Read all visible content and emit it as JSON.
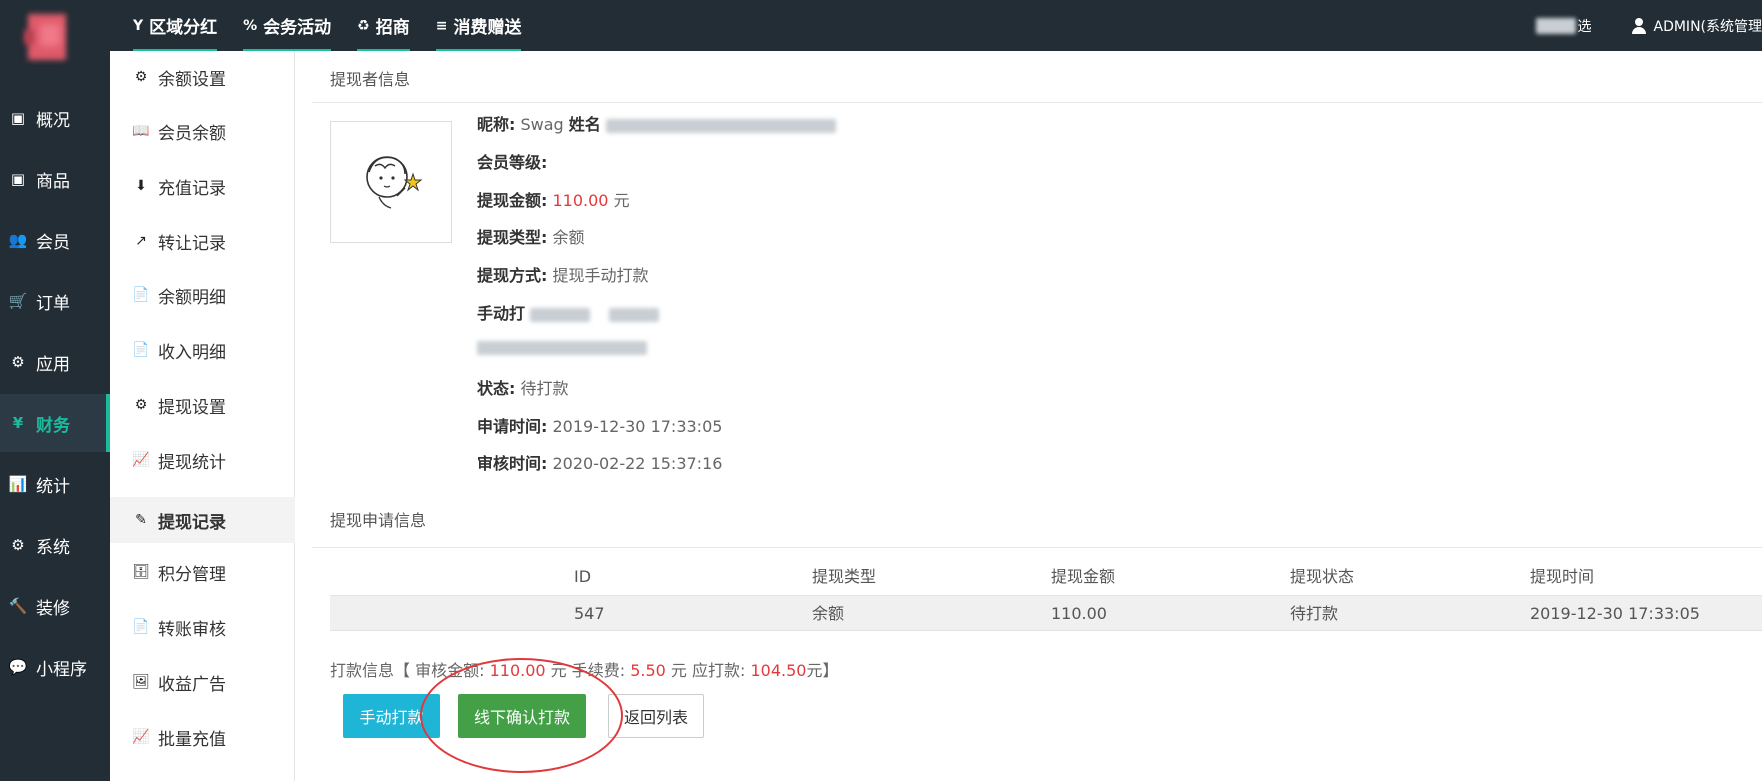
{
  "topnav": [
    {
      "icon": "Y",
      "label": "区域分红"
    },
    {
      "icon": "%",
      "label": "会务活动"
    },
    {
      "icon": "♻",
      "label": "招商"
    },
    {
      "icon": "≡",
      "label": "消费赠送"
    }
  ],
  "top_right": {
    "shop_select_label": "选",
    "user_label": "ADMIN(系统管理"
  },
  "sidebar": [
    {
      "icon": "▣",
      "label": "概况"
    },
    {
      "icon": "▣",
      "label": "商品"
    },
    {
      "icon": "👥",
      "label": "会员"
    },
    {
      "icon": "🛒",
      "label": "订单"
    },
    {
      "icon": "⚙",
      "label": "应用"
    },
    {
      "icon": "¥",
      "label": "财务"
    },
    {
      "icon": "📊",
      "label": "统计"
    },
    {
      "icon": "⚙",
      "label": "系统"
    },
    {
      "icon": "🔨",
      "label": "装修"
    },
    {
      "icon": "💬",
      "label": "小程序"
    }
  ],
  "subnav": [
    {
      "icon": "⚙",
      "label": "余额设置"
    },
    {
      "icon": "📖",
      "label": "会员余额"
    },
    {
      "icon": "⬇",
      "label": "充值记录"
    },
    {
      "icon": "↗",
      "label": "转让记录"
    },
    {
      "icon": "📄",
      "label": "余额明细"
    },
    {
      "icon": "📄",
      "label": "收入明细"
    },
    {
      "icon": "⚙",
      "label": "提现设置"
    },
    {
      "icon": "📈",
      "label": "提现统计"
    },
    {
      "icon": "✎",
      "label": "提现记录"
    },
    {
      "icon": "🗄",
      "label": "积分管理"
    },
    {
      "icon": "📄",
      "label": "转账审核"
    },
    {
      "icon": "🖼",
      "label": "收益广告"
    },
    {
      "icon": "📈",
      "label": "批量充值"
    }
  ],
  "withdrawer": {
    "section_title": "提现者信息",
    "nickname_label": "昵称:",
    "nickname": "Swag",
    "name_label": "姓名",
    "level_label": "会员等级:",
    "amount_label": "提现金额:",
    "amount": "110.00",
    "amount_unit": "元",
    "type_label": "提现类型:",
    "type": "余额",
    "method_label": "提现方式:",
    "method": "提现手动打款",
    "manual_label": "手动打",
    "status_label": "状态:",
    "status": "待打款",
    "apply_time_label": "申请时间:",
    "apply_time": "2019-12-30 17:33:05",
    "audit_time_label": "审核时间:",
    "audit_time": "2020-02-22 15:37:16"
  },
  "application": {
    "section_title": "提现申请信息",
    "columns": [
      "ID",
      "提现类型",
      "提现金额",
      "提现状态",
      "提现时间"
    ],
    "rows": [
      [
        "547",
        "余额",
        "110.00",
        "待打款",
        "2019-12-30 17:33:05"
      ]
    ]
  },
  "payment": {
    "prefix": "打款信息【 审核金额: ",
    "audit_amount": "110.00",
    "fee_label": " 元 手续费: ",
    "fee": "5.50",
    "payable_label": " 元 应打款: ",
    "payable": "104.50",
    "suffix": "元】"
  },
  "buttons": {
    "manual": "手动打款",
    "offline": "线下确认打款",
    "back": "返回列表"
  },
  "colors": {
    "sidebar_bg": "#222d35",
    "accent": "#1abc9c",
    "money_red": "#e4393c",
    "manual_btn": "#1fb5d6",
    "offline_btn": "#43a047"
  }
}
